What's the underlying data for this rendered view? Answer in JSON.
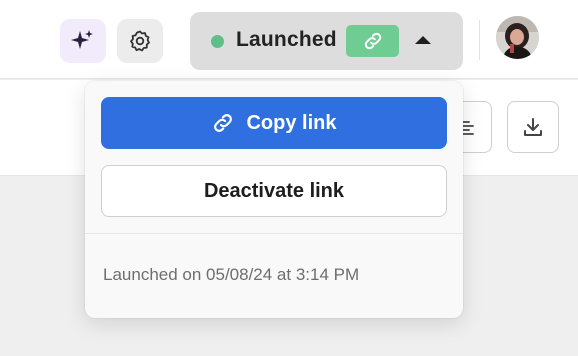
{
  "header": {
    "ai_icon": "sparkles-icon",
    "settings_icon": "gear-icon",
    "status": {
      "label": "Launched",
      "dot_color": "#5fbf87",
      "badge_icon": "link-icon",
      "badge_color": "#6fcc92",
      "caret_icon": "caret-up-icon"
    },
    "avatar_icon": "user-avatar"
  },
  "toolbar": {
    "align_icon": "align-icon",
    "download_icon": "download-icon"
  },
  "dropdown": {
    "copy_label": "Copy link",
    "copy_icon": "link-icon",
    "copy_color": "#2f6fe0",
    "deactivate_label": "Deactivate link",
    "launched_note": "Launched on 05/08/24 at 3:14 PM"
  }
}
